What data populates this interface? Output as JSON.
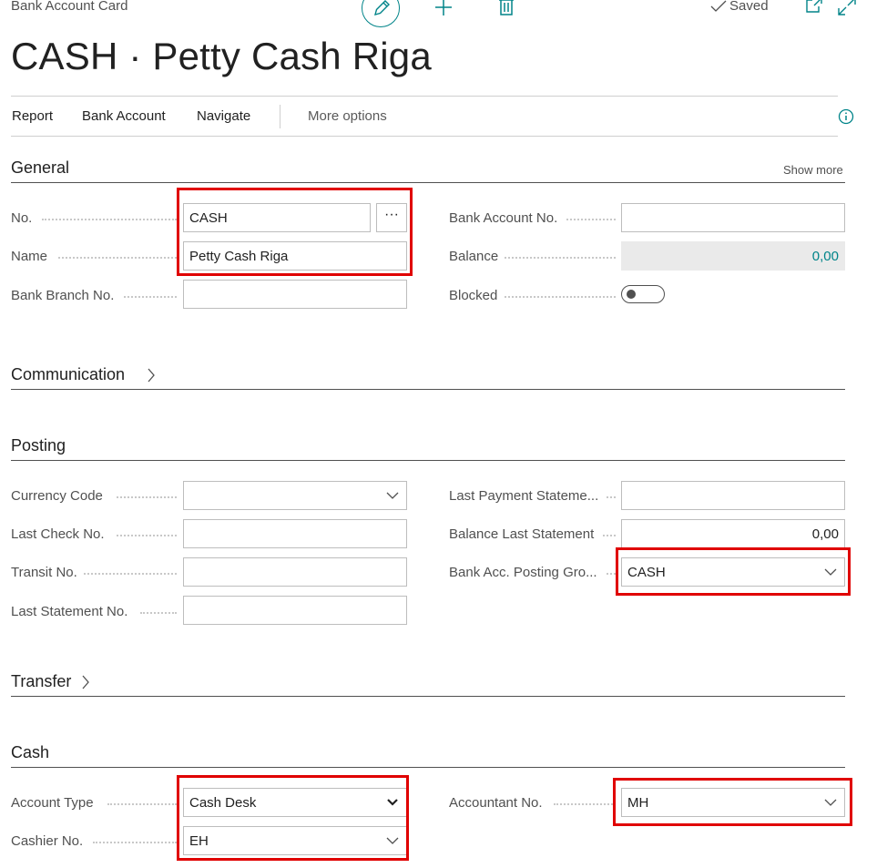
{
  "header": {
    "breadcrumb": "Bank Account Card",
    "saved_label": "Saved",
    "title": "CASH · Petty Cash Riga"
  },
  "actionbar": {
    "items": [
      "Report",
      "Bank Account",
      "Navigate"
    ],
    "more": "More options"
  },
  "general": {
    "title": "General",
    "show_more": "Show more",
    "no_label": "No.",
    "no_value": "CASH",
    "name_label": "Name",
    "name_value": "Petty Cash Riga",
    "branch_label": "Bank Branch No.",
    "branch_value": "",
    "bank_acc_label": "Bank Account No.",
    "bank_acc_value": "",
    "balance_label": "Balance",
    "balance_value": "0,00",
    "blocked_label": "Blocked",
    "blocked": false
  },
  "communication": {
    "title": "Communication"
  },
  "posting": {
    "title": "Posting",
    "currency_label": "Currency Code",
    "currency_value": "",
    "last_check_label": "Last Check No.",
    "last_check_value": "",
    "transit_label": "Transit No.",
    "transit_value": "",
    "last_stmt_label": "Last Statement No.",
    "last_stmt_value": "",
    "last_pay_label": "Last Payment Stateme...",
    "last_pay_value": "",
    "bal_last_label": "Balance Last Statement",
    "bal_last_value": "0,00",
    "posting_grp_label": "Bank Acc. Posting Gro...",
    "posting_grp_value": "CASH"
  },
  "transfer": {
    "title": "Transfer"
  },
  "cash": {
    "title": "Cash",
    "acct_type_label": "Account Type",
    "acct_type_value": "Cash Desk",
    "cashier_label": "Cashier No.",
    "cashier_value": "EH",
    "accountant_label": "Accountant No.",
    "accountant_value": "MH"
  },
  "colors": {
    "accent": "#008489",
    "highlight": "#e00000"
  }
}
